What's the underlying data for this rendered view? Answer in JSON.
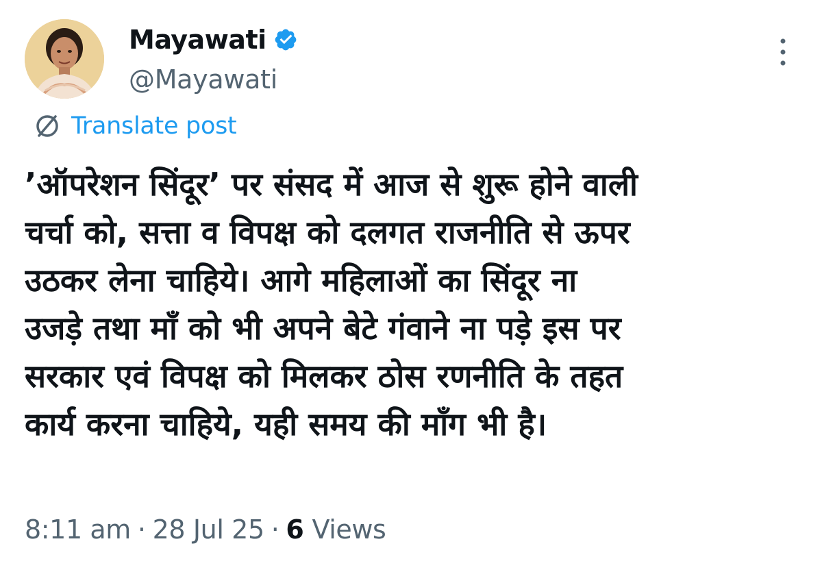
{
  "author": {
    "display_name": "Mayawati",
    "handle": "@Mayawati",
    "verified": true
  },
  "icons": {
    "avatar": "profile-photo",
    "verified": "verified-badge-icon",
    "more": "more-options-icon",
    "translate": "translate-globe-icon"
  },
  "translate_label": "Translate post",
  "post_lines": [
    "’ऑपरेशन सिंदूर’ पर संसद में आज से शुरू होने वाली",
    "चर्चा को, सत्ता व विपक्ष को दलगत राजनीति से ऊपर",
    "उठकर लेना चाहिये। आगे महिलाओं का सिंदूर ना",
    "उजड़े तथा माँ को भी अपने बेटे गंवाने ना पड़े इस पर",
    "सरकार एवं विपक्ष को मिलकर ठोस रणनीति के तहत",
    "कार्य करना चाहिये, यही समय की माँग भी है।"
  ],
  "meta": {
    "time": "8:11 am",
    "separator": "·",
    "date": "28 Jul 25",
    "views_count": "6",
    "views_label": "Views"
  },
  "colors": {
    "text_primary": "#0f1419",
    "text_secondary": "#536471",
    "accent_blue": "#1d9bf0",
    "background": "#ffffff"
  }
}
